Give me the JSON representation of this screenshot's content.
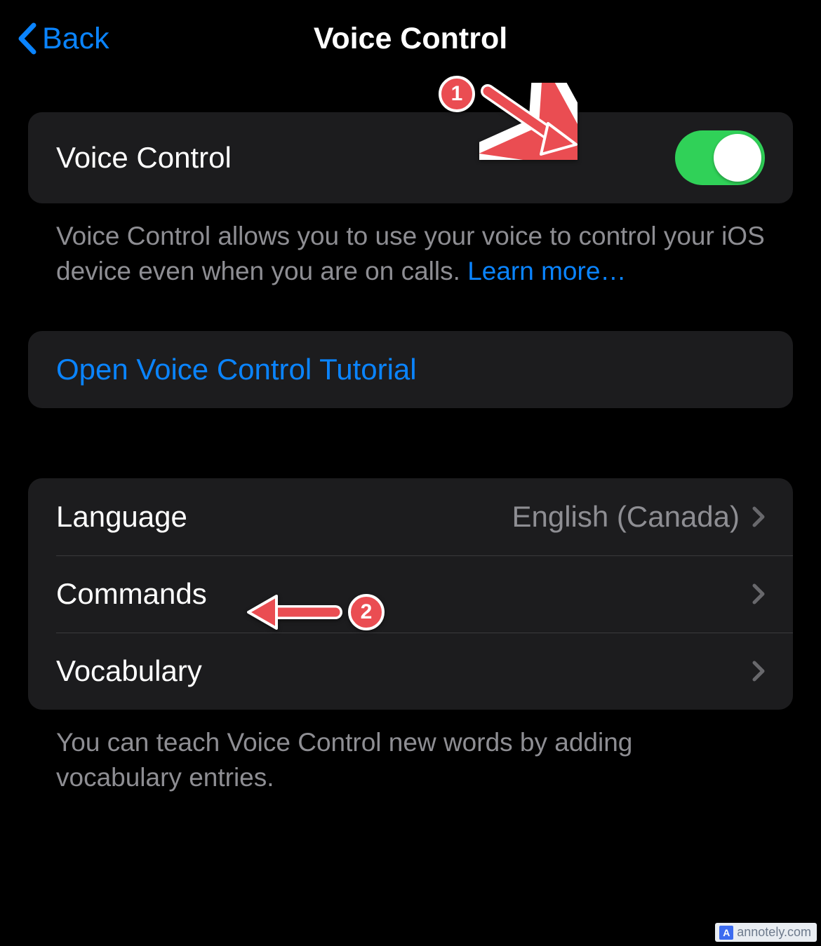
{
  "nav": {
    "back_label": "Back",
    "title": "Voice Control"
  },
  "section1": {
    "toggle_label": "Voice Control",
    "toggle_on": true,
    "footer_text": "Voice Control allows you to use your voice to control your iOS device even when you are on calls. ",
    "footer_link": "Learn more…"
  },
  "section2": {
    "tutorial_label": "Open Voice Control Tutorial"
  },
  "section3": {
    "rows": [
      {
        "label": "Language",
        "value": "English (Canada)"
      },
      {
        "label": "Commands",
        "value": ""
      },
      {
        "label": "Vocabulary",
        "value": ""
      }
    ],
    "footer_text": "You can teach Voice Control new words by adding vocabulary entries."
  },
  "annotations": {
    "one": "1",
    "two": "2"
  },
  "watermark": "annotely.com",
  "colors": {
    "accent_blue": "#0a84ff",
    "toggle_green": "#30d158",
    "cell_bg": "#1c1c1e",
    "annotation_red": "#ea4d52"
  }
}
